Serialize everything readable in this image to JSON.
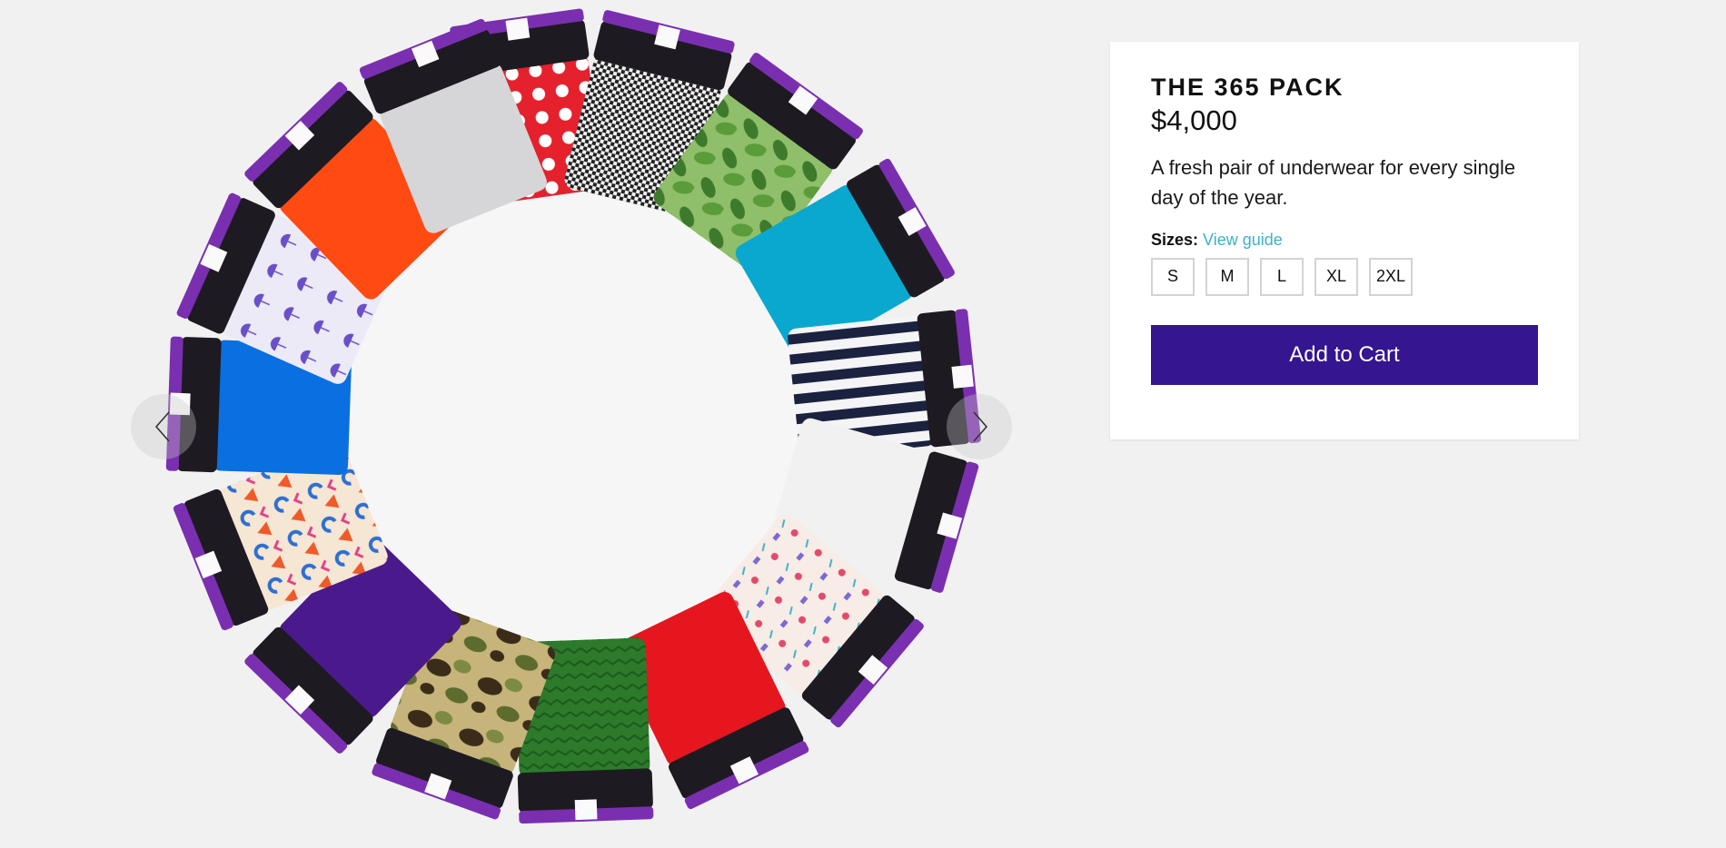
{
  "product": {
    "title": "THE 365 PACK",
    "price": "$4,000",
    "description": "A fresh pair of underwear for every single day of the year."
  },
  "sizes": {
    "label": "Sizes:",
    "guide_link": "View guide",
    "options": [
      "S",
      "M",
      "L",
      "XL",
      "2XL"
    ]
  },
  "cart": {
    "button_label": "Add to Cart"
  },
  "gallery": {
    "prev_icon": "chevron-left-icon",
    "next_icon": "chevron-right-icon"
  },
  "colors": {
    "accent": "#351590",
    "link": "#3bb2c9",
    "background": "#f2f1f2",
    "waistband": "#1e1a22",
    "waistband_trim": "#7a2fb0"
  }
}
